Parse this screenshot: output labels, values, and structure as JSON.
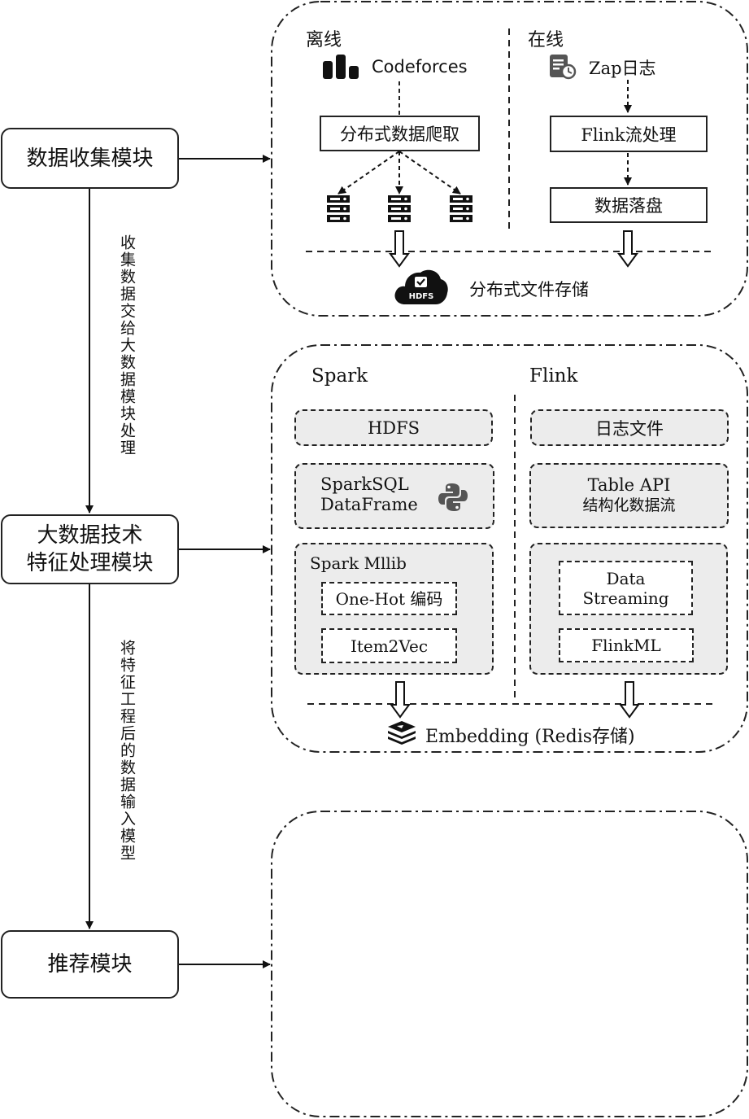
{
  "modules": {
    "collect": "数据收集模块",
    "bigdata_line1": "大数据技术",
    "bigdata_line2": "特征处理模块",
    "recommend": "推荐模块"
  },
  "edges": {
    "collect_to_bigdata": "收集数据交给大数据模块处理",
    "bigdata_to_recommend": "将特征工程后的数据输入模型"
  },
  "collection_panel": {
    "offline_title": "离线",
    "online_title": "在线",
    "codeforces": "Codeforces",
    "crawler": "分布式数据爬取",
    "zap_log": "Zap日志",
    "flink_stream": "Flink流处理",
    "persist": "数据落盘",
    "hdfs_badge": "HDFS",
    "storage": "分布式文件存储"
  },
  "feature_panel": {
    "spark_title": "Spark",
    "flink_title": "Flink",
    "hdfs": "HDFS",
    "sparksql": "SparkSQL",
    "dataframe": "DataFrame",
    "mllib": "Spark Mllib",
    "onehot": "One-Hot 编码",
    "item2vec": "Item2Vec",
    "log_file": "日志文件",
    "table_api": "Table API",
    "structured": "结构化数据流",
    "data": "Data",
    "streaming": "Streaming",
    "flinkml": "FlinkML",
    "embedding": "Embedding (Redis存储)"
  },
  "icons": [
    "bar-chart-icon",
    "server-icon",
    "log-file-icon",
    "hdfs-cloud-icon",
    "python-icon",
    "redis-stack-icon"
  ]
}
